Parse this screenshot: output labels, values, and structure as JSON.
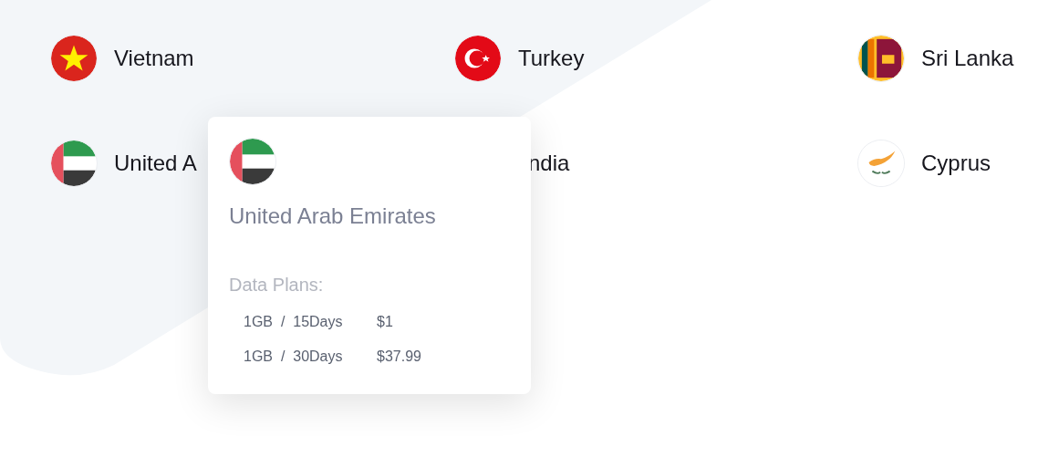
{
  "countries": [
    {
      "name": "Vietnam",
      "kind": "vietnam"
    },
    {
      "name": "Turkey",
      "kind": "turkey"
    },
    {
      "name": "Sri Lanka",
      "kind": "sri_lanka"
    },
    {
      "name": "United A",
      "kind": "uae"
    },
    {
      "name": "ndia"
    },
    {
      "name": "Cyprus",
      "kind": "cyprus"
    }
  ],
  "popup": {
    "kind": "uae",
    "title": "United Arab Emirates",
    "plans_label": "Data Plans:",
    "plans": [
      {
        "data": "1GB",
        "separator": "/",
        "duration": "15Days",
        "price": "$1"
      },
      {
        "data": "1GB",
        "separator": "/",
        "duration": "30Days",
        "price": "$37.99"
      }
    ]
  }
}
